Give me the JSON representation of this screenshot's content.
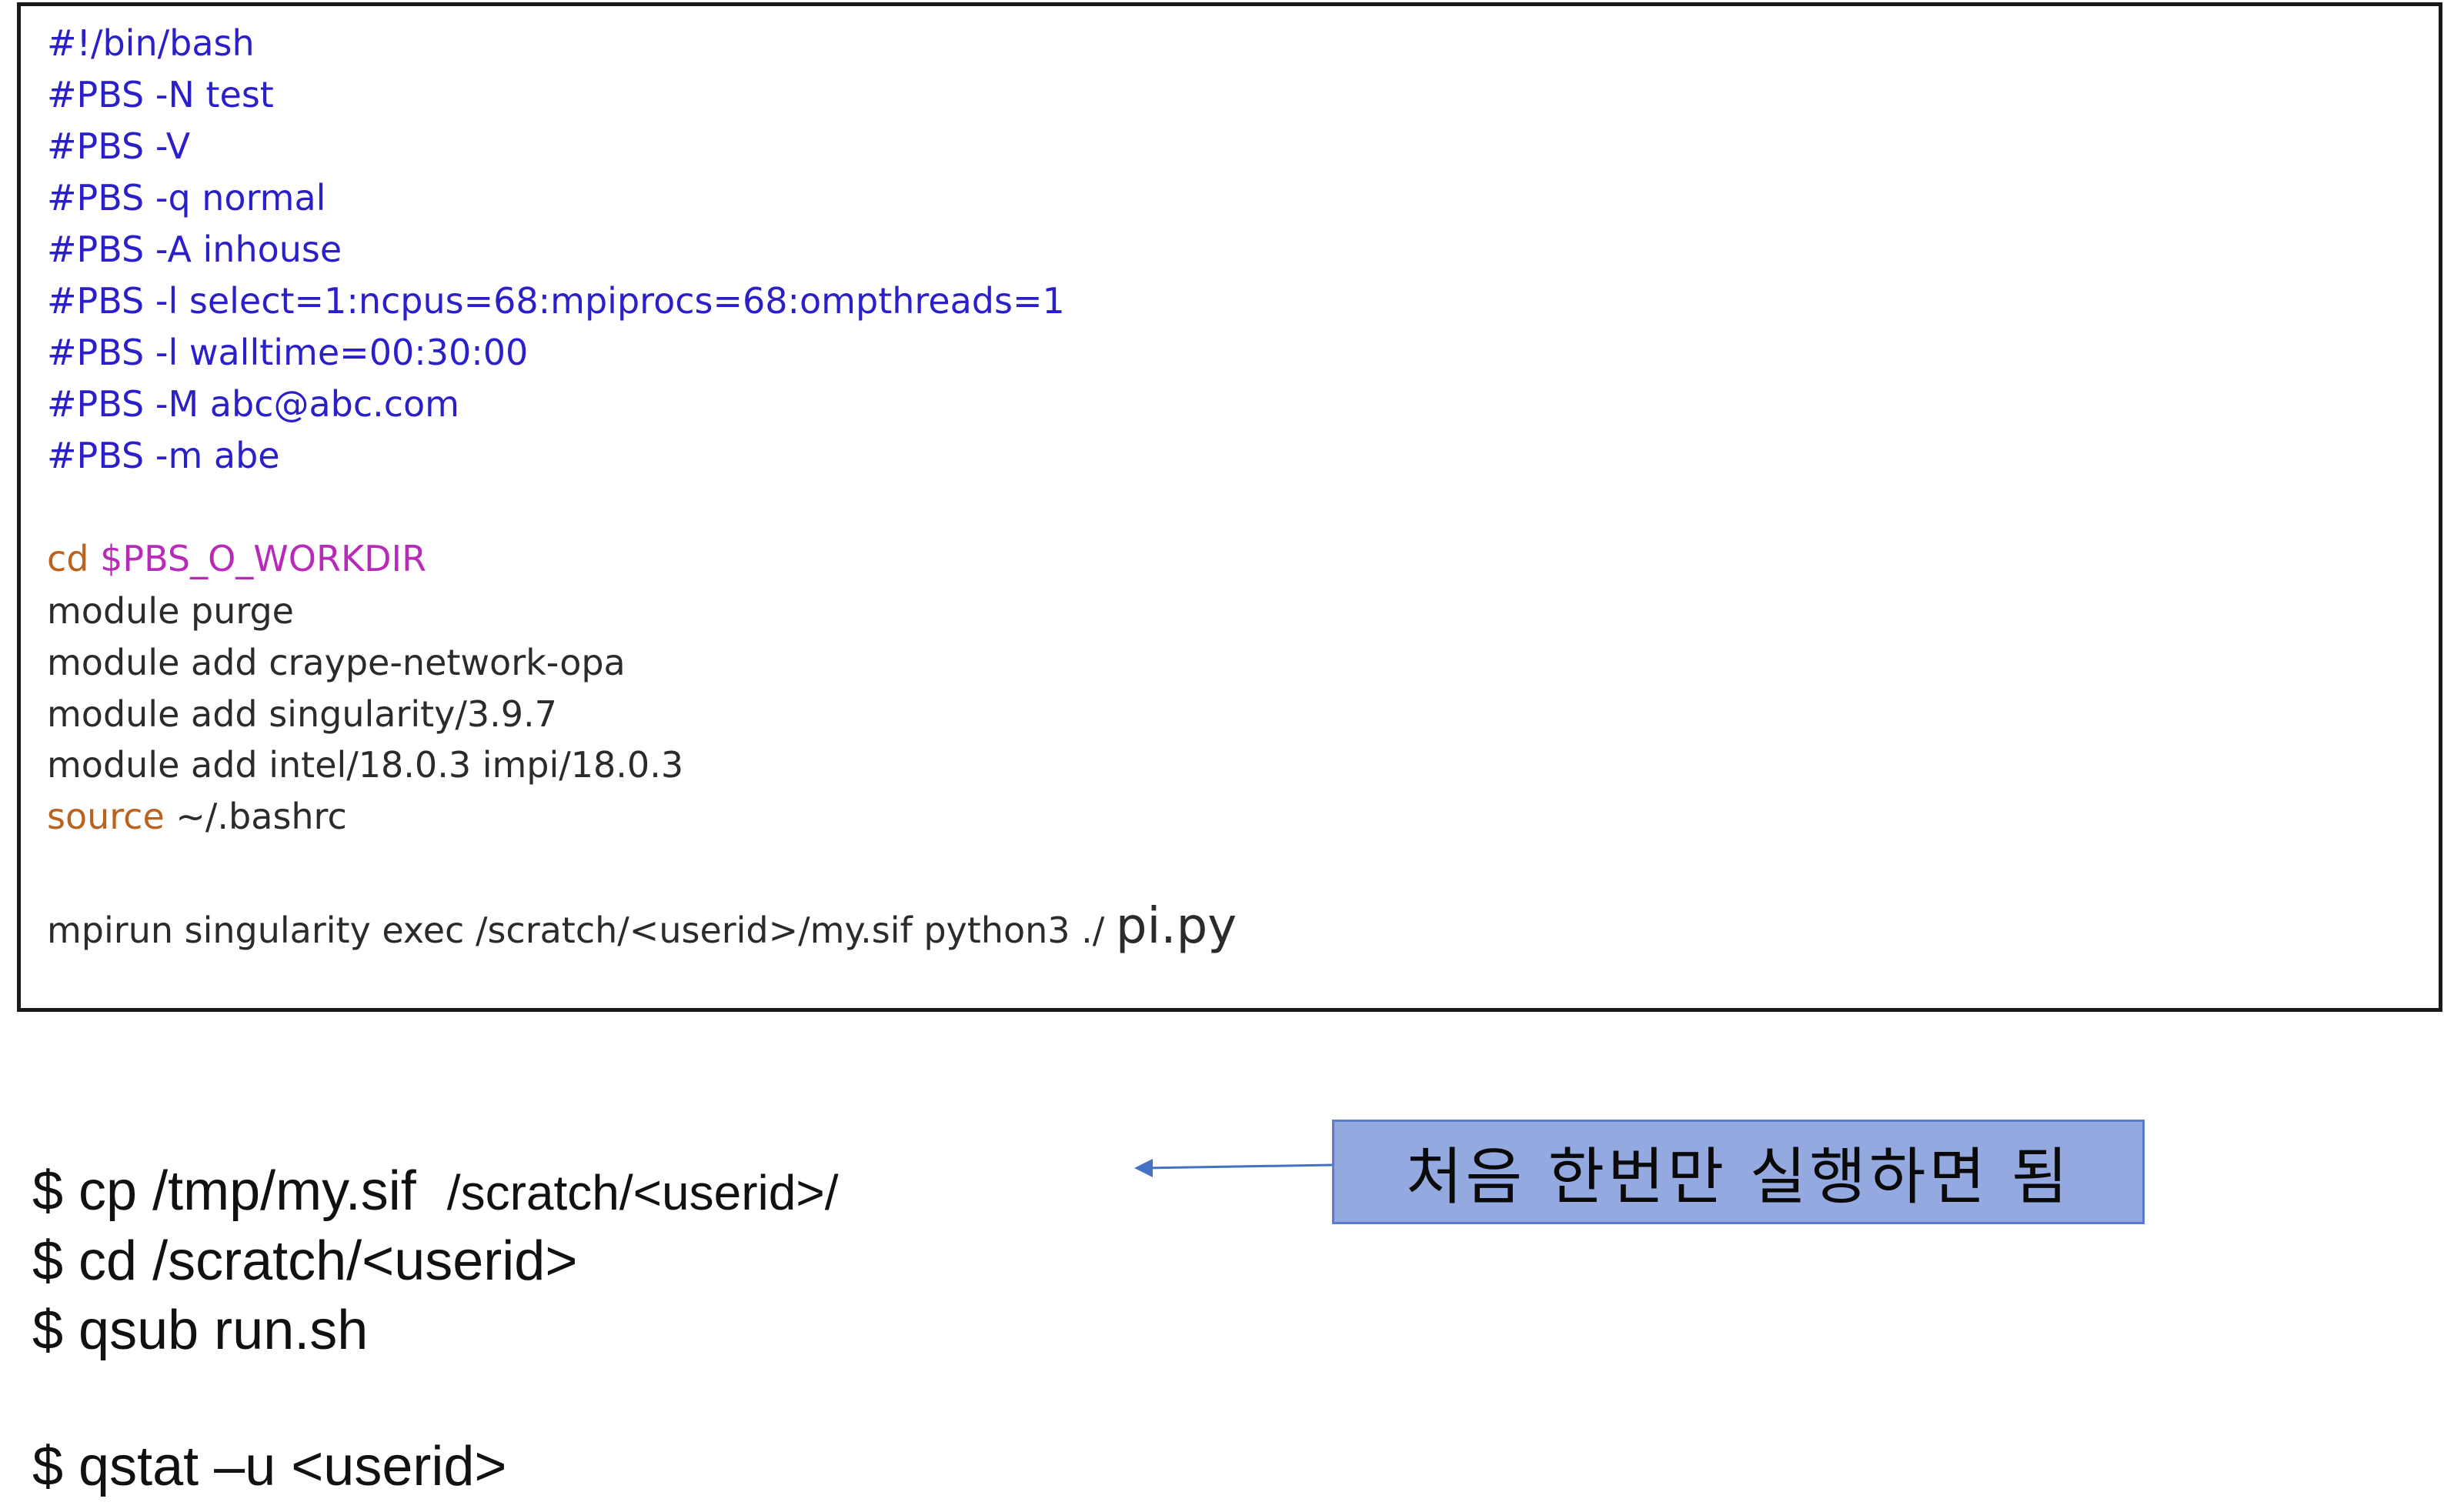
{
  "script": {
    "pbs_lines": [
      "#!/bin/bash",
      "#PBS -N test",
      "#PBS -V",
      "#PBS -q normal",
      "#PBS -A inhouse",
      "#PBS -l select=1:ncpus=68:mpiprocs=68:ompthreads=1",
      "#PBS -l walltime=00:30:00",
      "#PBS -M abc@abc.com",
      "#PBS -m abe"
    ],
    "cd_keyword": "cd",
    "cd_var": "$PBS_O_WORKDIR",
    "module_lines": [
      "module purge",
      "module add craype-network-opa",
      "module add singularity/3.9.7",
      "module add intel/18.0.3 impi/18.0.3"
    ],
    "source_keyword": "source",
    "source_arg": " ~/.bashrc",
    "mpirun_prefix": "mpirun singularity exec /scratch/<userid>/my.sif python3 ./ ",
    "mpirun_file": "pi.py"
  },
  "commands": {
    "cp_prefix": "$ cp /tmp/my.sif  ",
    "cp_path": "/scratch/<userid>/",
    "cd": "$ cd /scratch/<userid>",
    "qsub": "$ qsub run.sh",
    "qstat": "$ qstat –u <userid>"
  },
  "note": {
    "text": "처음 한번만 실행하면 됨"
  },
  "colors": {
    "pbs": "#2a1fc8",
    "keyword": "#b86420",
    "variable": "#b82ab8",
    "note_fill": "#93a9e0",
    "arrow": "#4472c4"
  }
}
